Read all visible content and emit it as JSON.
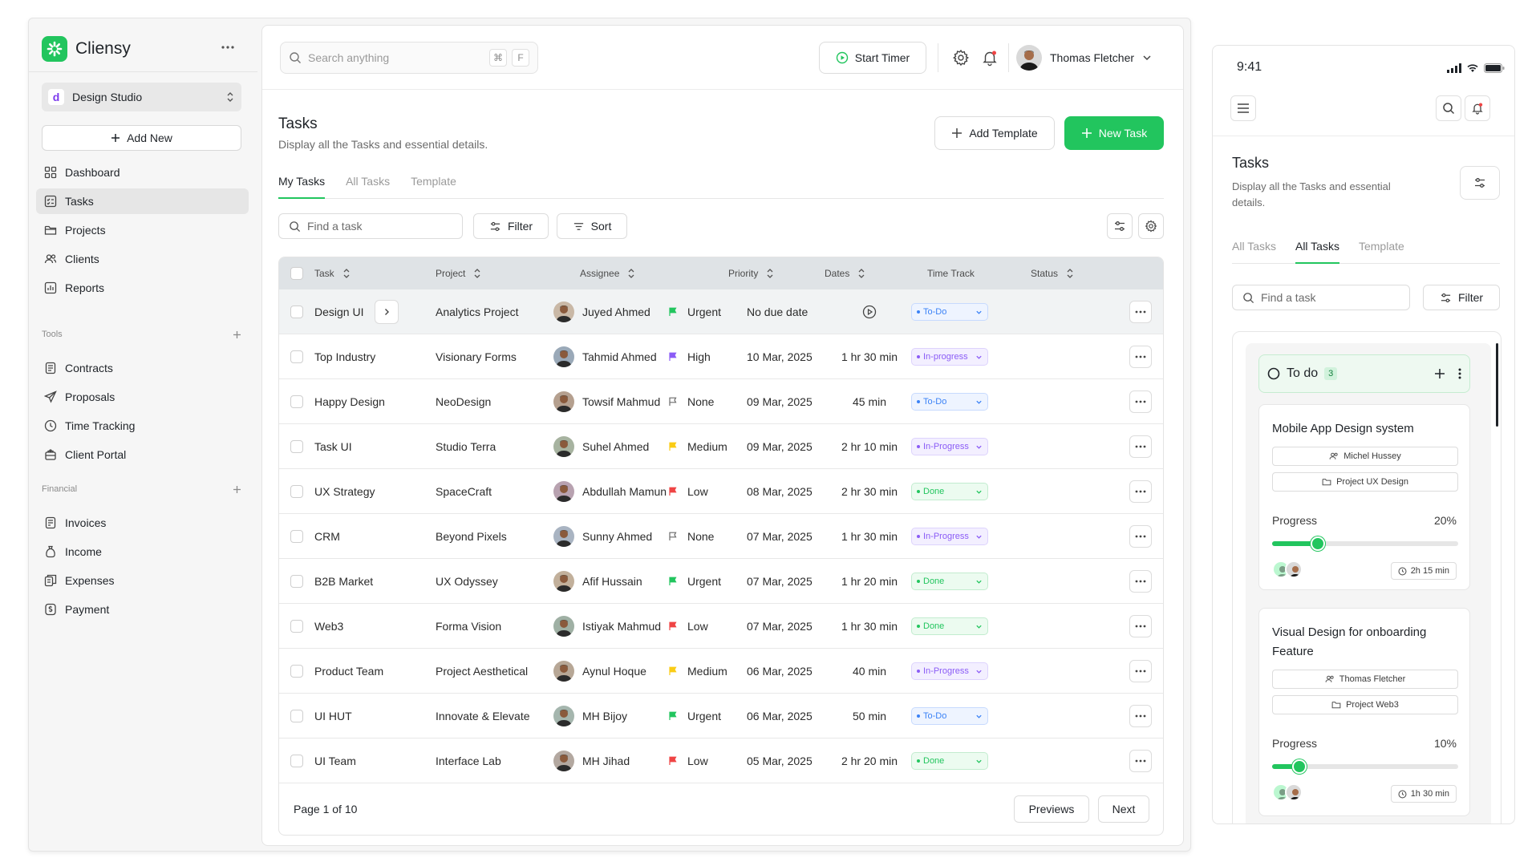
{
  "colors": {
    "accent": "#22c55e",
    "urgent_flag": "#22c55e",
    "high_flag": "#8b5cf6",
    "medium_flag": "#facc15",
    "low_flag": "#ef4444",
    "none_flag": "#6b6b6b"
  },
  "sidebar": {
    "brand": "Cliensy",
    "workspace": {
      "badge": "d",
      "name": "Design Studio"
    },
    "add_new": "Add New",
    "nav": [
      {
        "label": "Dashboard",
        "icon": "grid-icon"
      },
      {
        "label": "Tasks",
        "icon": "tasks-icon",
        "active": true
      },
      {
        "label": "Projects",
        "icon": "folder-icon"
      },
      {
        "label": "Clients",
        "icon": "users-icon"
      },
      {
        "label": "Reports",
        "icon": "chart-icon"
      }
    ],
    "tools_label": "Tools",
    "tools": [
      {
        "label": "Contracts",
        "icon": "document-icon"
      },
      {
        "label": "Proposals",
        "icon": "send-icon"
      },
      {
        "label": "Time Tracking",
        "icon": "clock-icon"
      },
      {
        "label": "Client Portal",
        "icon": "portal-icon"
      }
    ],
    "financial_label": "Financial",
    "financial": [
      {
        "label": "Invoices",
        "icon": "invoice-icon"
      },
      {
        "label": "Income",
        "icon": "money-bag-icon"
      },
      {
        "label": "Expenses",
        "icon": "expenses-icon"
      },
      {
        "label": "Payment",
        "icon": "payment-icon"
      }
    ]
  },
  "topbar": {
    "search_placeholder": "Search anything",
    "kbd": [
      "⌘",
      "F"
    ],
    "timer_label": "Start Timer",
    "user_name": "Thomas Fletcher"
  },
  "page": {
    "title": "Tasks",
    "subtitle": "Display all the Tasks and essential details.",
    "add_template": "Add Template",
    "new_task": "New Task",
    "tabs": [
      "My Tasks",
      "All Tasks",
      "Template"
    ],
    "find_placeholder": "Find a task",
    "filter": "Filter",
    "sort": "Sort"
  },
  "table": {
    "columns": [
      "Task",
      "Project",
      "Assignee",
      "Priority",
      "Dates",
      "Time Track",
      "Status"
    ],
    "rows": [
      {
        "task": "Design UI",
        "project": "Analytics Project",
        "assignee": "Juyed Ahmed",
        "priority": "Urgent",
        "date": "No due date",
        "time": "",
        "status": "To-Do"
      },
      {
        "task": "Top Industry",
        "project": "Visionary Forms",
        "assignee": "Tahmid Ahmed",
        "priority": "High",
        "date": "10 Mar, 2025",
        "time": "1 hr 30 min",
        "status": "In-progress"
      },
      {
        "task": "Happy Design",
        "project": "NeoDesign",
        "assignee": "Towsif Mahmud",
        "priority": "None",
        "date": "09 Mar, 2025",
        "time": "45 min",
        "status": "To-Do"
      },
      {
        "task": "Task UI",
        "project": "Studio Terra",
        "assignee": "Suhel Ahmed",
        "priority": "Medium",
        "date": "09 Mar, 2025",
        "time": "2 hr 10 min",
        "status": "In-Progress"
      },
      {
        "task": "UX Strategy",
        "project": "SpaceCraft",
        "assignee": "Abdullah Mamun",
        "priority": "Low",
        "date": "08 Mar, 2025",
        "time": "2 hr 30 min",
        "status": "Done"
      },
      {
        "task": "CRM",
        "project": "Beyond Pixels",
        "assignee": "Sunny Ahmed",
        "priority": "None",
        "date": "07 Mar, 2025",
        "time": "1 hr 30 min",
        "status": "In-Progress"
      },
      {
        "task": "B2B Market",
        "project": "UX Odyssey",
        "assignee": "Afif Hussain",
        "priority": "Urgent",
        "date": "07 Mar, 2025",
        "time": "1 hr 20 min",
        "status": "Done"
      },
      {
        "task": "Web3",
        "project": "Forma Vision",
        "assignee": "Istiyak Mahmud",
        "priority": "Low",
        "date": "07 Mar, 2025",
        "time": "1 hr 30 min",
        "status": "Done"
      },
      {
        "task": "Product Team",
        "project": "Project Aesthetical",
        "assignee": "Aynul Hoque",
        "priority": "Medium",
        "date": "06 Mar, 2025",
        "time": "40 min",
        "status": "In-Progress"
      },
      {
        "task": "UI HUT",
        "project": "Innovate & Elevate",
        "assignee": "MH Bijoy",
        "priority": "Urgent",
        "date": "06 Mar, 2025",
        "time": "50 min",
        "status": "To-Do"
      },
      {
        "task": "UI Team",
        "project": "Interface Lab",
        "assignee": "MH Jihad",
        "priority": "Low",
        "date": "05 Mar, 2025",
        "time": "2 hr 20 min",
        "status": "Done"
      }
    ],
    "page_text": "Page 1 of 10",
    "previous": "Previews",
    "next": "Next"
  },
  "mobile": {
    "time": "9:41",
    "title": "Tasks",
    "subtitle": "Display all the Tasks and essential details.",
    "tabs": [
      "All Tasks",
      "All Tasks",
      "Template"
    ],
    "active_tab": 1,
    "find_placeholder": "Find a task",
    "filter": "Filter",
    "column_title": "To do",
    "column_count": "3",
    "cards": [
      {
        "title": "Mobile App Design system",
        "person": "Michel Hussey",
        "project": "Project UX Design",
        "progress_label": "Progress",
        "progress": "20%",
        "progress_value": 0.2,
        "time": "2h 15 min"
      },
      {
        "title": "Visual Design for onboarding Feature",
        "person": "Thomas Fletcher",
        "project": "Project Web3",
        "progress_label": "Progress",
        "progress": "10%",
        "progress_value": 0.1,
        "time": "1h 30 min"
      }
    ]
  }
}
